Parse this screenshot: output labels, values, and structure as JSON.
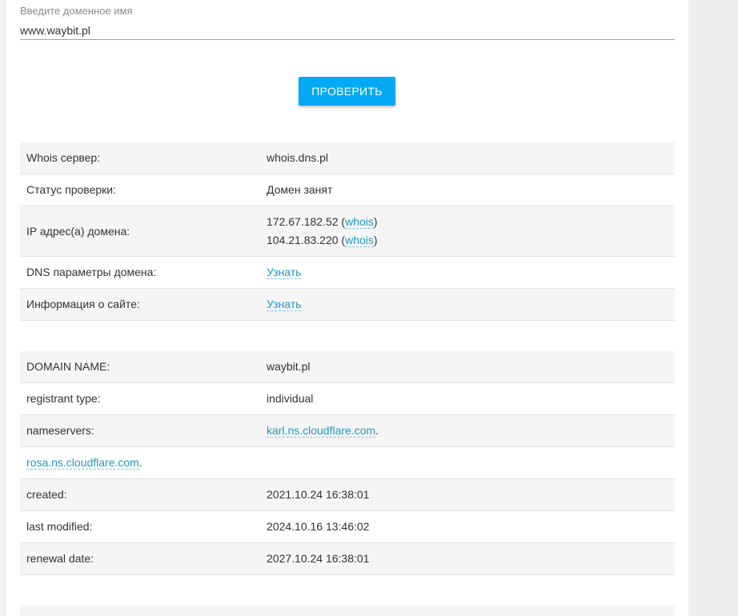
{
  "search": {
    "label": "Введите доменное имя",
    "value": "www.waybit.pl"
  },
  "check_button": "ПРОВЕРИТЬ",
  "summary": {
    "whois_server": {
      "key": "Whois сервер:",
      "value": "whois.dns.pl"
    },
    "status": {
      "key": "Статус проверки:",
      "value": "Домен занят"
    },
    "ip": {
      "key": "IP адрес(а) домена:",
      "addresses": [
        {
          "ip": "172.67.182.52",
          "link": "whois"
        },
        {
          "ip": "104.21.83.220",
          "link": "whois"
        }
      ]
    },
    "dns": {
      "key": "DNS параметры домена:",
      "link": "Узнать"
    },
    "site_info": {
      "key": "Информация о сайте:",
      "link": "Узнать"
    }
  },
  "whois": {
    "domain_name": {
      "key": "DOMAIN NAME:",
      "value": "waybit.pl"
    },
    "registrant_type": {
      "key": "registrant type:",
      "value": "individual"
    },
    "nameservers": {
      "key": "nameservers:",
      "ns1": "karl.ns.cloudflare.com",
      "ns2": "rosa.ns.cloudflare.com"
    },
    "created": {
      "key": "created:",
      "value": "2021.10.24 16:38:01"
    },
    "last_modified": {
      "key": "last modified:",
      "value": "2024.10.16 13:46:02"
    },
    "renewal_date": {
      "key": "renewal date:",
      "value": "2027.10.24 16:38:01"
    }
  },
  "colors": {
    "accent": "#03a9f4",
    "link": "#2196c8",
    "stripe": "#f5f5f5"
  }
}
